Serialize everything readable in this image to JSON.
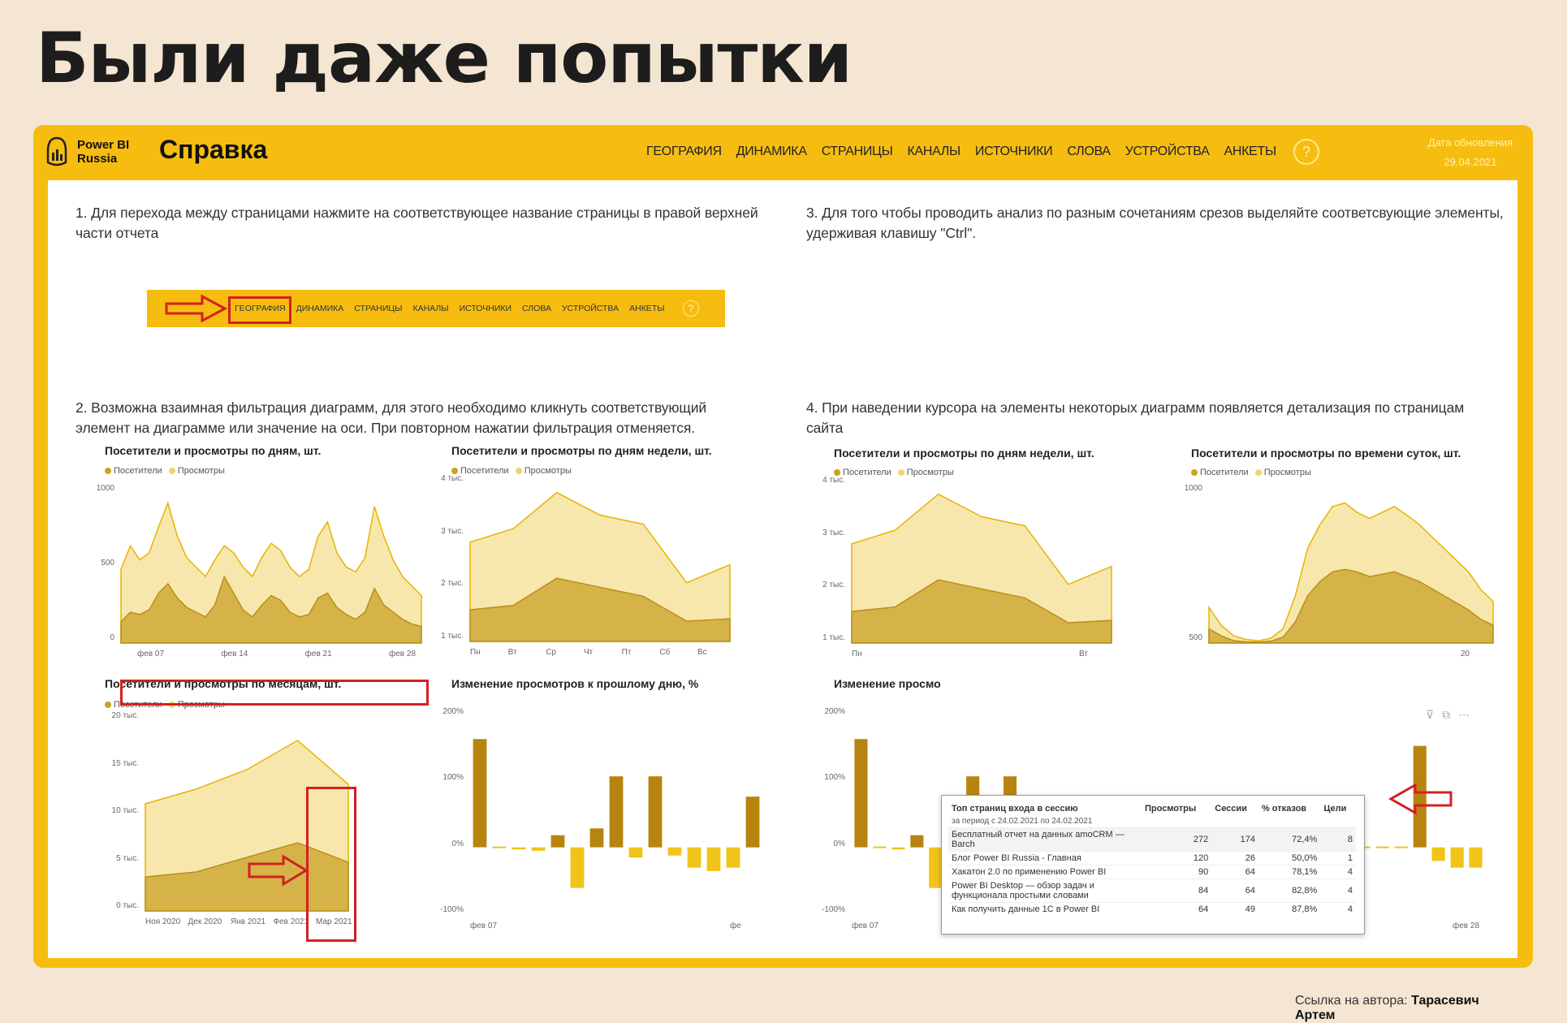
{
  "slide": {
    "title": "Были даже попытки"
  },
  "header": {
    "logo_line1": "Power BI",
    "logo_line2": "Russia",
    "page_title": "Справка",
    "nav": [
      "ГЕОГРАФИЯ",
      "ДИНАМИКА",
      "СТРАНИЦЫ",
      "КАНАЛЫ",
      "ИСТОЧНИКИ",
      "СЛОВА",
      "УСТРОЙСТВА",
      "АНКЕТЫ"
    ],
    "help": "?",
    "update_label": "Дата обновления",
    "update_date": "29.04.2021"
  },
  "instructions": {
    "i1": "1. Для перехода между страницами нажмите на соответствующее название страницы  в правой верхней части отчета",
    "i2": "2. Возможна взаимная фильтрация диаграмм,  для этого необходимо кликнуть соответствующий элемент на  диаграмме или значение на оси.   При повторном нажатии фильтрация отменяется.",
    "i3": "3. Для того чтобы проводить анализ по разным сочетаниям срезов выделяйте соответсвующие элементы, удерживая клавишу \"Ctrl\".",
    "i4": "4. При наведении курсора на элементы некоторых диаграмм появляется детализация по страницам сайта"
  },
  "legend": {
    "visitors": "Посетители",
    "views": "Просмотры"
  },
  "colors": {
    "visitors": "#c9a227",
    "views": "#f3d46a",
    "accent": "#f6bd10",
    "bar_up": "#b7850f",
    "bar_down": "#f0c419",
    "red": "#d42020"
  },
  "chart_data": [
    {
      "type": "area",
      "title": "Посетители и просмотры по дням, шт.",
      "x_ticks": [
        "фев 07",
        "фев 14",
        "фев 21",
        "фев 28"
      ],
      "y_ticks": [
        "1000",
        "500",
        "0"
      ],
      "ylim": [
        0,
        1300
      ],
      "series": [
        {
          "name": "Просмотры",
          "values": [
            620,
            820,
            700,
            760,
            980,
            1180,
            900,
            720,
            640,
            560,
            700,
            820,
            760,
            640,
            560,
            720,
            840,
            780,
            640,
            560,
            620,
            900,
            1020,
            760,
            640,
            600,
            720,
            1150,
            900,
            700,
            560,
            480,
            400
          ]
        },
        {
          "name": "Посетители",
          "values": [
            180,
            260,
            240,
            280,
            420,
            500,
            380,
            300,
            260,
            220,
            320,
            560,
            420,
            280,
            220,
            320,
            400,
            360,
            260,
            220,
            240,
            380,
            420,
            300,
            240,
            200,
            260,
            460,
            320,
            260,
            200,
            160,
            140
          ]
        }
      ]
    },
    {
      "type": "area",
      "title": "Посетители и просмотры по дням недели, шт.",
      "x_ticks": [
        "Пн",
        "Вт",
        "Ср",
        "Чт",
        "Пт",
        "Сб",
        "Вс"
      ],
      "y_ticks": [
        "4 тыс.",
        "3 тыс.",
        "2 тыс.",
        "1 тыс."
      ],
      "ylim": [
        0,
        3600
      ],
      "series": [
        {
          "name": "Просмотры",
          "values": [
            2200,
            2500,
            3300,
            2800,
            2600,
            1300,
            1700
          ]
        },
        {
          "name": "Посетители",
          "values": [
            700,
            800,
            1400,
            1200,
            1000,
            450,
            500
          ]
        }
      ]
    },
    {
      "type": "area",
      "title": "Посетители и просмотры по месяцам, шт.",
      "x_ticks": [
        "Ноя 2020",
        "Дек 2020",
        "Янв 2021",
        "Фев 2021",
        "Мар 2021"
      ],
      "y_ticks": [
        "20 тыс.",
        "15 тыс.",
        "10 тыс.",
        "5 тыс.",
        "0 тыс."
      ],
      "ylim": [
        0,
        20000
      ],
      "series": [
        {
          "name": "Просмотры",
          "values": [
            11000,
            12500,
            14500,
            17500,
            13000
          ]
        },
        {
          "name": "Посетители",
          "values": [
            3500,
            4000,
            5500,
            7000,
            5000
          ]
        }
      ]
    },
    {
      "type": "bar",
      "title": "Изменение просмотров к прошлому дню, %",
      "x_ticks": [
        "фев 07",
        "фе"
      ],
      "y_ticks": [
        "200%",
        "100%",
        "0%",
        "-100%"
      ],
      "ylim": [
        -100,
        200
      ],
      "values": [
        160,
        0,
        -3,
        -5,
        18,
        -60,
        28,
        105,
        -15,
        105,
        -12,
        -30,
        -35,
        -30,
        75
      ]
    },
    {
      "type": "area",
      "title": "Посетители и просмотры по дням недели, шт.",
      "x_ticks": [
        "Пн",
        "Вт"
      ],
      "y_ticks": [
        "4 тыс.",
        "3 тыс.",
        "2 тыс.",
        "1 тыс."
      ],
      "ylim": [
        0,
        3600
      ],
      "series": [
        {
          "name": "Просмотры",
          "values": [
            2200,
            2500,
            3300,
            2800,
            2600,
            1300,
            1700
          ]
        },
        {
          "name": "Посетители",
          "values": [
            700,
            800,
            1400,
            1200,
            1000,
            450,
            500
          ]
        }
      ]
    },
    {
      "type": "area",
      "title": "Посетители и просмотры по времени суток, шт.",
      "x_ticks": [
        "20"
      ],
      "y_ticks": [
        "1000",
        "500"
      ],
      "ylim": [
        0,
        1300
      ],
      "series": [
        {
          "name": "Просмотры",
          "values": [
            300,
            150,
            60,
            30,
            20,
            40,
            120,
            400,
            800,
            1000,
            1150,
            1180,
            1100,
            1050,
            1100,
            1150,
            1080,
            1000,
            900,
            800,
            700,
            600,
            450,
            350
          ]
        },
        {
          "name": "Посетители",
          "values": [
            120,
            60,
            20,
            10,
            8,
            15,
            50,
            180,
            400,
            520,
            600,
            620,
            600,
            560,
            580,
            600,
            560,
            520,
            460,
            400,
            340,
            280,
            200,
            150
          ]
        }
      ]
    },
    {
      "type": "bar",
      "title": "Изменение просмо",
      "x_ticks": [
        "фев 07",
        "фев 14",
        "фев 21",
        "фев 28"
      ],
      "y_ticks": [
        "200%",
        "100%",
        "0%",
        "-100%"
      ],
      "ylim": [
        -100,
        200
      ],
      "values": [
        160,
        0,
        -3,
        18,
        -60,
        28,
        105,
        -15,
        105,
        -12,
        -30,
        -35,
        -30,
        75,
        20,
        -5,
        -10,
        25,
        -40,
        -30,
        20,
        35,
        -35,
        -20,
        -35,
        10,
        0,
        0,
        0,
        0,
        150,
        -20,
        -30,
        -30
      ]
    }
  ],
  "tooltip": {
    "title": "Топ страниц входа в сессию",
    "subtitle": "за период с 24.02.2021 по 24.02.2021",
    "columns": [
      "Просмотры",
      "Сессии",
      "% отказов",
      "Цели"
    ],
    "rows": [
      [
        "Бесплатный отчет на данных amoCRM — Barch",
        "272",
        "174",
        "72,4%",
        "8"
      ],
      [
        "Блог Power BI Russia - Главная",
        "120",
        "26",
        "50,0%",
        "1"
      ],
      [
        "Хакатон 2.0 по применению Power BI",
        "90",
        "64",
        "78,1%",
        "4"
      ],
      [
        "Power BI Desktop — обзор задач и функционала простыми словами",
        "84",
        "64",
        "82,8%",
        "4"
      ],
      [
        "Как получить данные 1С в Power BI",
        "64",
        "49",
        "87,8%",
        "4"
      ]
    ]
  },
  "footer": {
    "label": "Ссылка на автора:",
    "author": "Тарасевич Артем"
  }
}
